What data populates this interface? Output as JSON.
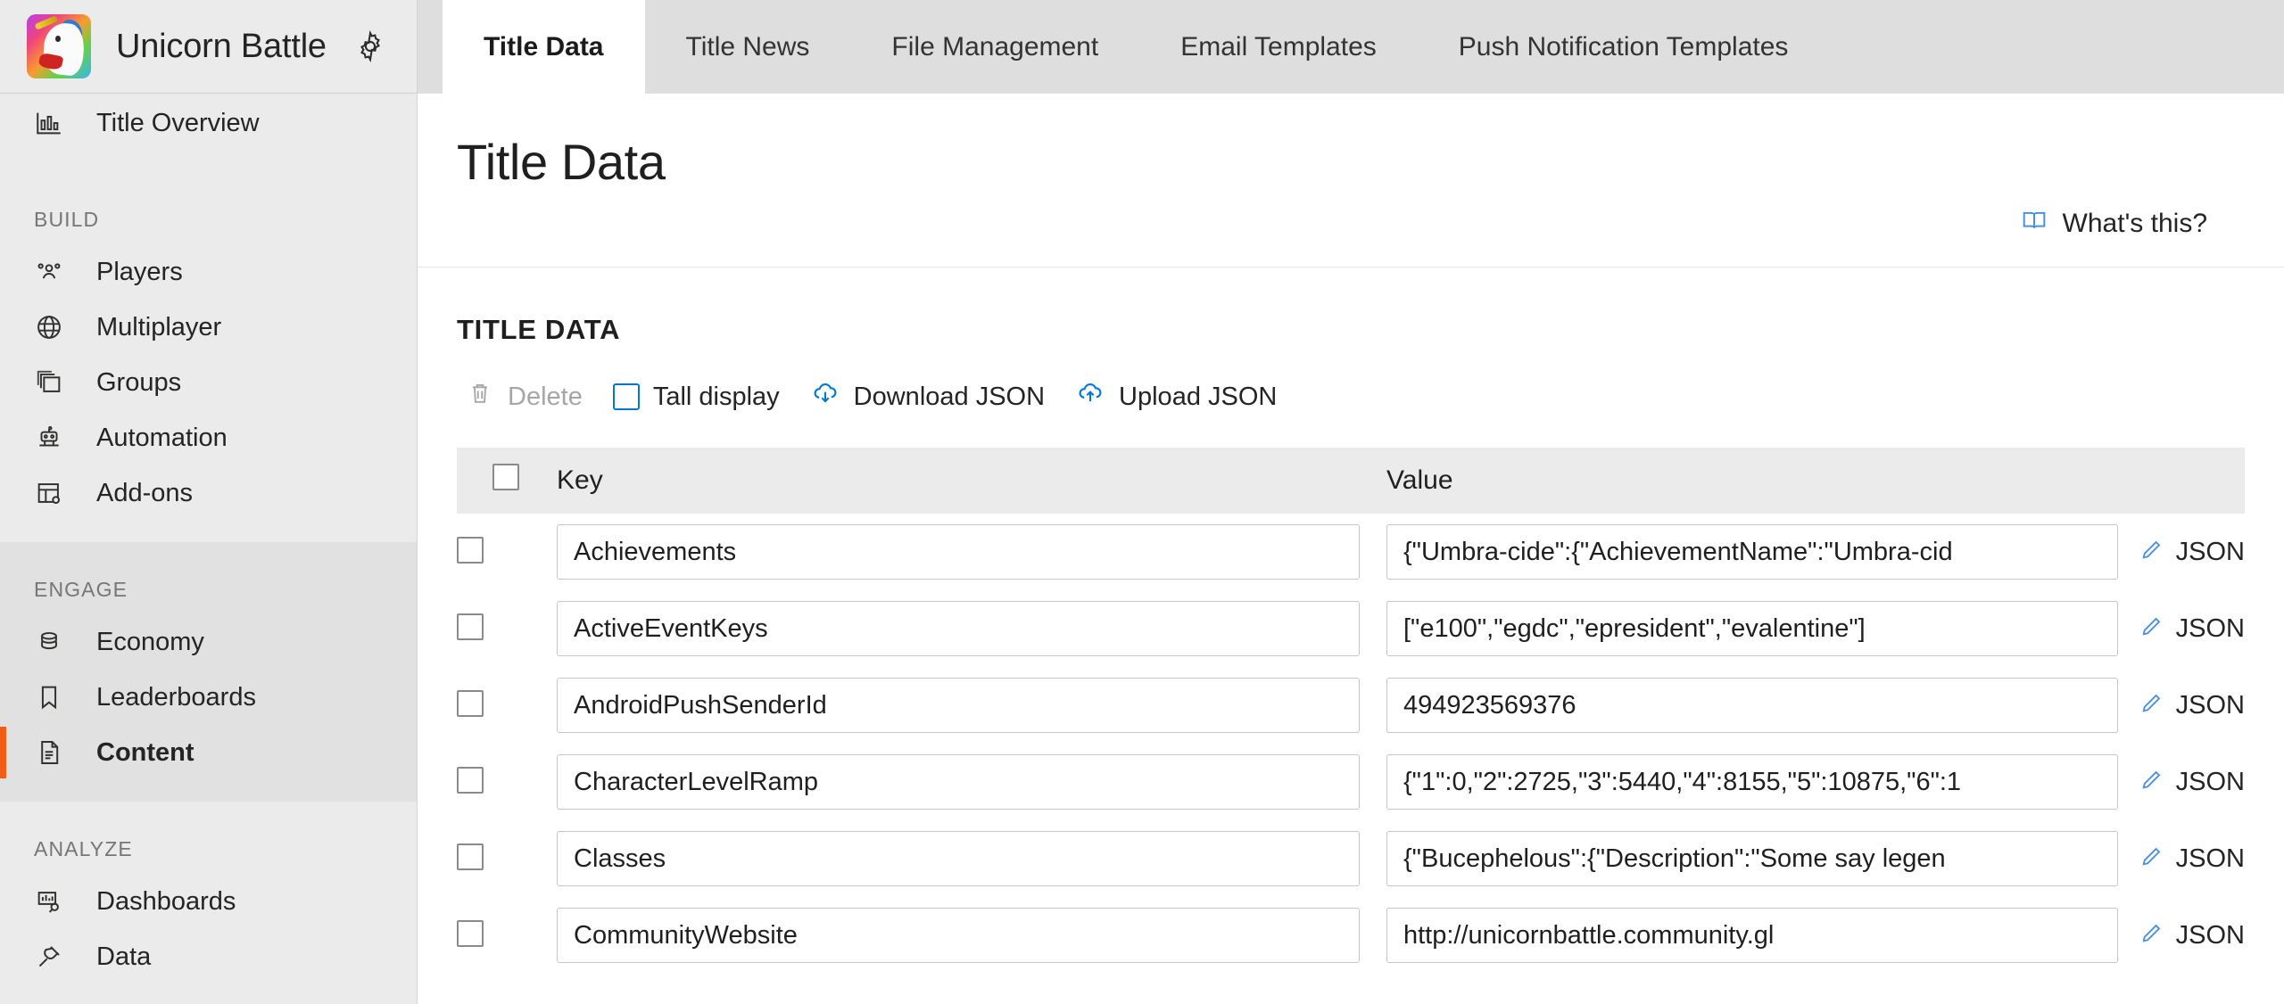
{
  "sidebar": {
    "brand": {
      "title": "Unicorn Battle",
      "logo_icon": "unicorn-logo-icon",
      "settings_icon": "gear-icon"
    },
    "top_items": [
      {
        "label": "Title Overview",
        "icon": "bar-chart-icon"
      }
    ],
    "sections": [
      {
        "title": "BUILD",
        "items": [
          {
            "label": "Players",
            "icon": "people-icon"
          },
          {
            "label": "Multiplayer",
            "icon": "globe-icon"
          },
          {
            "label": "Groups",
            "icon": "stacked-squares-icon"
          },
          {
            "label": "Automation",
            "icon": "robot-icon"
          },
          {
            "label": "Add-ons",
            "icon": "table-gear-icon"
          }
        ]
      },
      {
        "title": "ENGAGE",
        "items": [
          {
            "label": "Economy",
            "icon": "coins-icon"
          },
          {
            "label": "Leaderboards",
            "icon": "bookmark-icon"
          },
          {
            "label": "Content",
            "icon": "document-icon",
            "selected": true
          }
        ]
      },
      {
        "title": "ANALYZE",
        "items": [
          {
            "label": "Dashboards",
            "icon": "dashboard-search-icon"
          },
          {
            "label": "Data",
            "icon": "plug-icon"
          }
        ]
      }
    ]
  },
  "tabs": [
    {
      "label": "Title Data",
      "active": true
    },
    {
      "label": "Title News",
      "active": false
    },
    {
      "label": "File Management",
      "active": false
    },
    {
      "label": "Email Templates",
      "active": false
    },
    {
      "label": "Push Notification Templates",
      "active": false
    }
  ],
  "page": {
    "title": "Title Data",
    "whats_this": {
      "label": "What's this?",
      "icon": "book-icon"
    }
  },
  "section": {
    "heading": "TITLE DATA",
    "toolbar": [
      {
        "label": "Delete",
        "icon": "trash-icon",
        "disabled": true
      },
      {
        "label": "Tall display",
        "icon": "checkbox-icon",
        "disabled": false
      },
      {
        "label": "Download JSON",
        "icon": "cloud-download-icon",
        "disabled": false
      },
      {
        "label": "Upload JSON",
        "icon": "cloud-upload-icon",
        "disabled": false
      }
    ],
    "table": {
      "columns": [
        "Key",
        "Value"
      ],
      "json_link_label": "JSON",
      "edit_icon": "pencil-icon",
      "rows": [
        {
          "key": "Achievements",
          "value": "{\"Umbra-cide\":{\"AchievementName\":\"Umbra-cid"
        },
        {
          "key": "ActiveEventKeys",
          "value": "[\"e100\",\"egdc\",\"epresident\",\"evalentine\"]"
        },
        {
          "key": "AndroidPushSenderId",
          "value": "494923569376"
        },
        {
          "key": "CharacterLevelRamp",
          "value": "{\"1\":0,\"2\":2725,\"3\":5440,\"4\":8155,\"5\":10875,\"6\":1"
        },
        {
          "key": "Classes",
          "value": "{\"Bucephelous\":{\"Description\":\"Some say legen"
        },
        {
          "key": "CommunityWebsite",
          "value": "http://unicornbattle.community.gl"
        }
      ]
    }
  },
  "colors": {
    "accent_orange": "#f25c19",
    "link_blue": "#0078d4",
    "sidebar_bg": "#ebebeb",
    "sidebar_shaded_bg": "#e1e1e1",
    "tabbar_bg": "#dedede"
  }
}
